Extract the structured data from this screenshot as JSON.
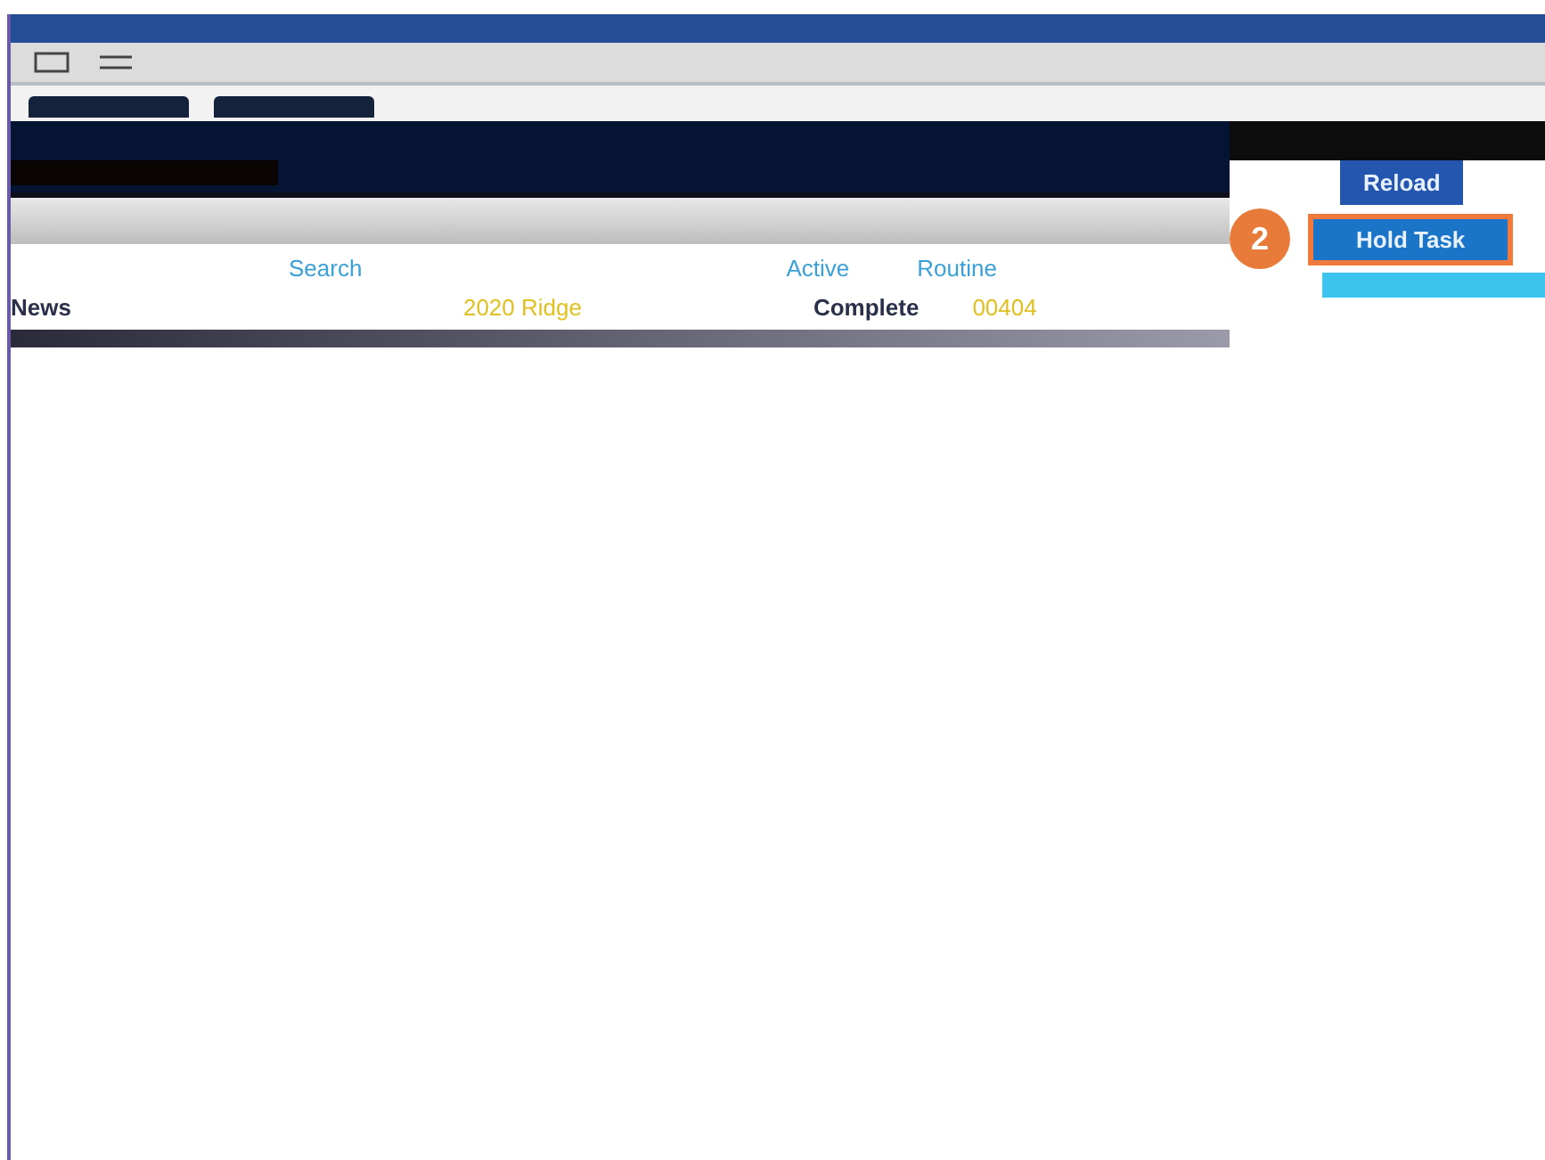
{
  "rows": [
    [
      {
        "text": "Search",
        "kind": "link"
      },
      {
        "text": "Active",
        "kind": "link"
      },
      {
        "text": "Routine",
        "kind": "link"
      }
    ],
    [
      {
        "text": "News",
        "kind": "label"
      },
      {
        "text": "2020 Ridge",
        "kind": "value"
      },
      {
        "text": "Complete",
        "kind": "label"
      },
      {
        "text": "00404",
        "kind": "value"
      }
    ]
  ],
  "actions": [
    {
      "label": "Reload",
      "highlighted": false
    },
    {
      "label": "Hold Task",
      "highlighted": true
    }
  ],
  "callout": {
    "number": "2"
  }
}
